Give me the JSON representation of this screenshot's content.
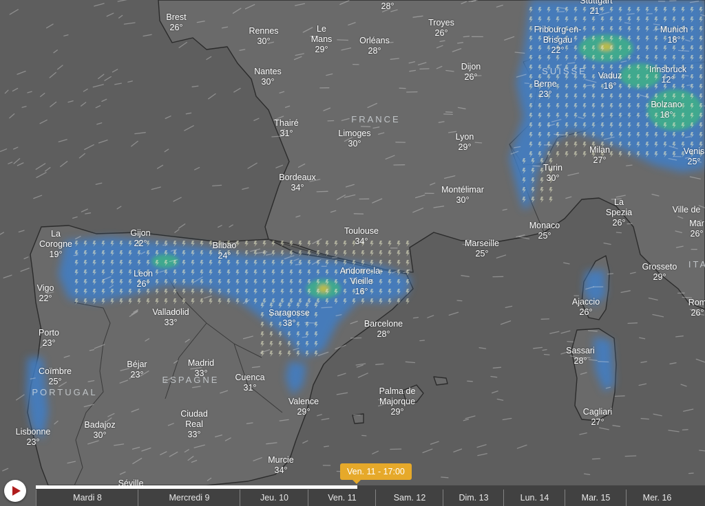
{
  "colors": {
    "sea": "#5f5f5f",
    "land": "#6a6a6a",
    "coast": "#2b2b2b",
    "rain_light": "#3f7fc8",
    "rain_medium": "#3fae8a",
    "rain_heavy": "#c7c23a",
    "timeline_accent": "#e6a92a",
    "play_icon": "#b01d1d"
  },
  "countries": [
    {
      "id": "france",
      "label": "FRANCE"
    },
    {
      "id": "espagne",
      "label": "ESPAGNE"
    },
    {
      "id": "portugal",
      "label": "PORTUGAL"
    },
    {
      "id": "suisse",
      "label": "SUISSE"
    },
    {
      "id": "italie",
      "label": "ITA"
    }
  ],
  "cities": [
    {
      "id": "brest",
      "name": "Brest",
      "temp": "26°"
    },
    {
      "id": "rennes",
      "name": "Rennes",
      "temp": "30°"
    },
    {
      "id": "le-mans",
      "name": "Le\nMans",
      "temp": "29°"
    },
    {
      "id": "orleans",
      "name": "Orléans",
      "temp": "28°"
    },
    {
      "id": "paris",
      "name": "",
      "temp": "28°"
    },
    {
      "id": "troyes",
      "name": "Troyes",
      "temp": "26°"
    },
    {
      "id": "stuttgart",
      "name": "Stuttgart",
      "temp": "21°"
    },
    {
      "id": "fribourg",
      "name": "Fribourg-en-\nBrisgau",
      "temp": "22°"
    },
    {
      "id": "munich",
      "name": "Munich",
      "temp": "18°"
    },
    {
      "id": "nantes",
      "name": "Nantes",
      "temp": "30°"
    },
    {
      "id": "dijon",
      "name": "Dijon",
      "temp": "26°"
    },
    {
      "id": "vaduz",
      "name": "Vaduz",
      "temp": "16°"
    },
    {
      "id": "innsbruck",
      "name": "Innsbruck",
      "temp": "12°"
    },
    {
      "id": "berne",
      "name": "Berne",
      "temp": "23°"
    },
    {
      "id": "bolzano",
      "name": "Bolzano",
      "temp": "18°"
    },
    {
      "id": "thaire",
      "name": "Thairé",
      "temp": "31°"
    },
    {
      "id": "limoges",
      "name": "Limoges",
      "temp": "30°"
    },
    {
      "id": "lyon",
      "name": "Lyon",
      "temp": "29°"
    },
    {
      "id": "milan",
      "name": "Milan",
      "temp": "27°"
    },
    {
      "id": "venise",
      "name": "Venis",
      "temp": "25°"
    },
    {
      "id": "turin",
      "name": "Turin",
      "temp": "30°"
    },
    {
      "id": "bordeaux",
      "name": "Bordeaux",
      "temp": "34°"
    },
    {
      "id": "montelimar",
      "name": "Montélimar",
      "temp": "30°"
    },
    {
      "id": "la-spezia",
      "name": "La\nSpezia",
      "temp": "26°"
    },
    {
      "id": "ville-de",
      "name": "Ville de",
      "temp": ""
    },
    {
      "id": "mar",
      "name": "Mar",
      "temp": "26°"
    },
    {
      "id": "monaco",
      "name": "Monaco",
      "temp": "25°"
    },
    {
      "id": "la-corogne",
      "name": "La\nCorogne",
      "temp": "19°"
    },
    {
      "id": "gijon",
      "name": "Gijon",
      "temp": "22°"
    },
    {
      "id": "bilbao",
      "name": "Bilbao",
      "temp": "24°"
    },
    {
      "id": "toulouse",
      "name": "Toulouse",
      "temp": "34°"
    },
    {
      "id": "marseille",
      "name": "Marseille",
      "temp": "25°"
    },
    {
      "id": "leon",
      "name": "Leon",
      "temp": "26°"
    },
    {
      "id": "andorre",
      "name": "Andorre-la-\nVieille",
      "temp": "16°"
    },
    {
      "id": "vigo",
      "name": "Vigo",
      "temp": "22°"
    },
    {
      "id": "grosseto",
      "name": "Grosseto",
      "temp": "29°"
    },
    {
      "id": "ajaccio",
      "name": "Ajaccio",
      "temp": "26°"
    },
    {
      "id": "rom",
      "name": "Rom",
      "temp": "26°"
    },
    {
      "id": "valladolid",
      "name": "Valladolid",
      "temp": "33°"
    },
    {
      "id": "saragosse",
      "name": "Saragosse",
      "temp": "33°"
    },
    {
      "id": "barcelone",
      "name": "Barcelone",
      "temp": "28°"
    },
    {
      "id": "porto",
      "name": "Porto",
      "temp": "23°"
    },
    {
      "id": "sassari",
      "name": "Sassari",
      "temp": "28°"
    },
    {
      "id": "bejar",
      "name": "Béjar",
      "temp": "23°"
    },
    {
      "id": "madrid",
      "name": "Madrid",
      "temp": "33°"
    },
    {
      "id": "coimbre",
      "name": "Coïmbre",
      "temp": "25°"
    },
    {
      "id": "cuenca",
      "name": "Cuenca",
      "temp": "31°"
    },
    {
      "id": "valence",
      "name": "Valence",
      "temp": "29°"
    },
    {
      "id": "palma",
      "name": "Palma de\nMajorque",
      "temp": "29°"
    },
    {
      "id": "cagliari",
      "name": "Cagliari",
      "temp": "27°"
    },
    {
      "id": "badajoz",
      "name": "Badajoz",
      "temp": "30°"
    },
    {
      "id": "ciudad-real",
      "name": "Ciudad\nReal",
      "temp": "33°"
    },
    {
      "id": "lisbonne",
      "name": "Lisbonne",
      "temp": "23°"
    },
    {
      "id": "murcie",
      "name": "Murcie",
      "temp": "34°"
    },
    {
      "id": "seville",
      "name": "Séville",
      "temp": ""
    }
  ],
  "timeline": {
    "current_time": "Ven. 11 - 17:00",
    "progress": 0.48,
    "days": [
      "Mardi 8",
      "Mercredi 9",
      "Jeu. 10",
      "Ven. 11",
      "Sam. 12",
      "Dim. 13",
      "Lun. 14",
      "Mar. 15",
      "Mer. 16"
    ]
  }
}
